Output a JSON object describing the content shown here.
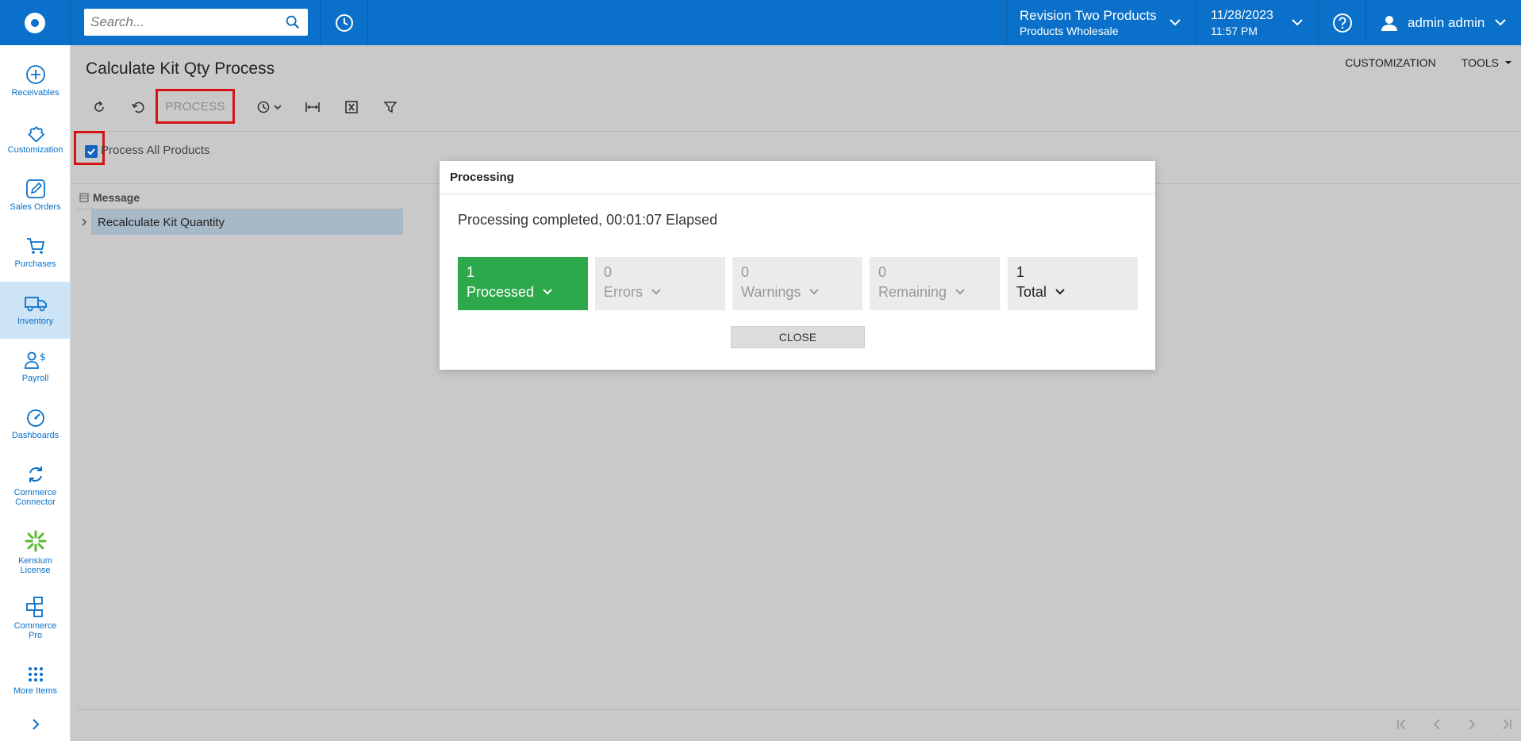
{
  "topbar": {
    "search_placeholder": "Search...",
    "tenant_name": "Revision Two Products",
    "tenant_sub": "Products Wholesale",
    "date": "11/28/2023",
    "time": "11:57 PM",
    "user_name": "admin admin"
  },
  "sidebar": {
    "items": [
      {
        "label": "Receivables",
        "icon": "plus-circle-icon"
      },
      {
        "label": "Customization",
        "icon": "puzzle-icon"
      },
      {
        "label": "Sales Orders",
        "icon": "pencil-square-icon"
      },
      {
        "label": "Purchases",
        "icon": "cart-icon"
      },
      {
        "label": "Inventory",
        "icon": "truck-icon"
      },
      {
        "label": "Payroll",
        "icon": "person-dollar-icon"
      },
      {
        "label": "Dashboards",
        "icon": "gauge-icon"
      },
      {
        "label": "Commerce Connector",
        "icon": "sync-icon"
      },
      {
        "label": "Kensium License",
        "icon": "kensium-icon"
      },
      {
        "label": "Commerce Pro",
        "icon": "commerce-pro-icon"
      },
      {
        "label": "More Items",
        "icon": "grid-dots-icon"
      }
    ],
    "active_index": 4
  },
  "page": {
    "title": "Calculate Kit Qty Process",
    "customization_label": "CUSTOMIZATION",
    "tools_label": "TOOLS",
    "process_label": "PROCESS",
    "process_all_label": "Process All Products",
    "process_all_checked": true
  },
  "grid": {
    "column_header": "Message",
    "rows": [
      {
        "message": "Recalculate Kit Quantity"
      }
    ]
  },
  "modal": {
    "title": "Processing",
    "message": "Processing completed, 00:01:07 Elapsed",
    "stats": [
      {
        "count": "1",
        "label": "Processed"
      },
      {
        "count": "0",
        "label": "Errors"
      },
      {
        "count": "0",
        "label": "Warnings"
      },
      {
        "count": "0",
        "label": "Remaining"
      },
      {
        "count": "1",
        "label": "Total"
      }
    ],
    "close_label": "CLOSE"
  },
  "colors": {
    "brand_blue": "#0a70c9",
    "success_green": "#2da84b",
    "highlight_red": "#d41414"
  }
}
